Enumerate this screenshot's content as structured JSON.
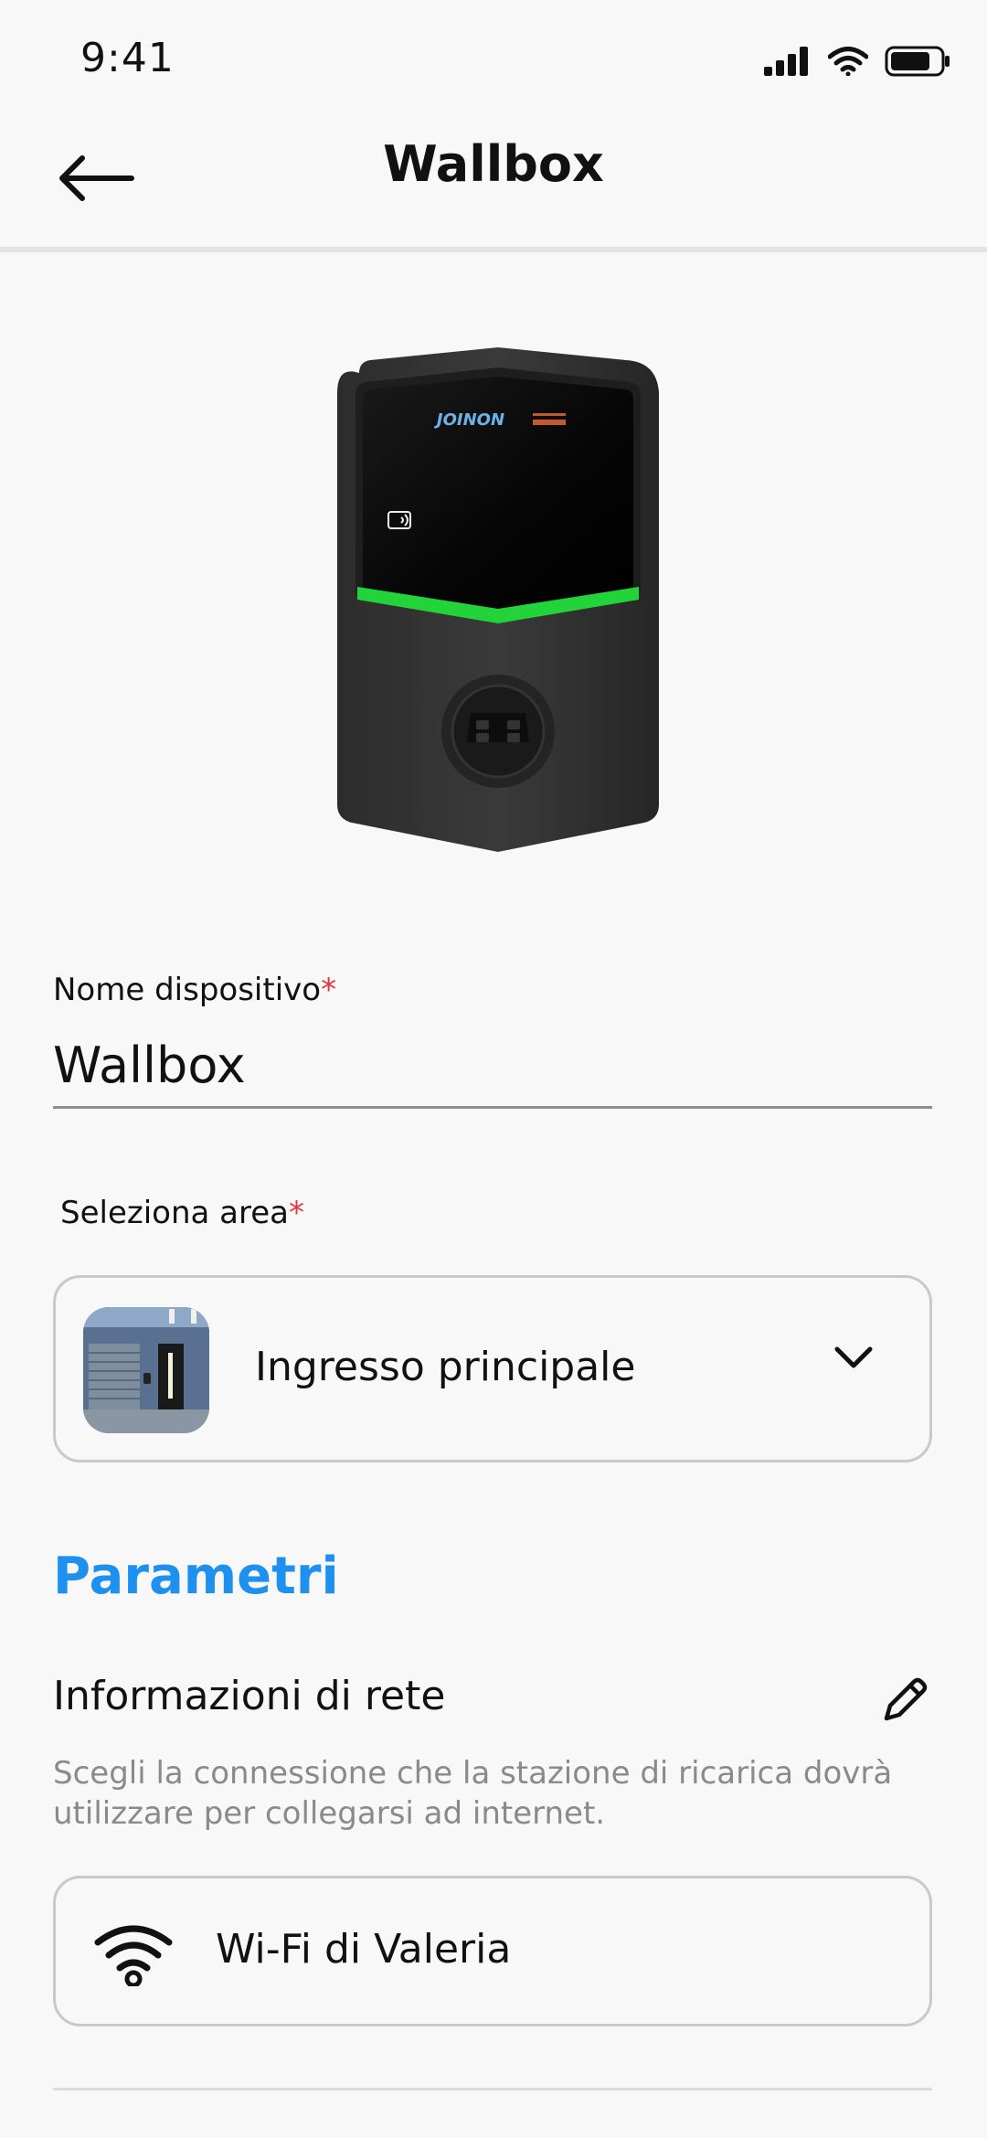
{
  "status_bar": {
    "time": "9:41",
    "icons": [
      "cellular-signal-icon",
      "wifi-icon",
      "battery-icon"
    ]
  },
  "header": {
    "title": "Wallbox",
    "back_icon": "arrow-left-icon"
  },
  "device": {
    "brand_logo": "JOINON"
  },
  "form": {
    "name_label": "Nome dispositivo",
    "name_required": "*",
    "name_value": "Wallbox",
    "area_label": "Seleziona area",
    "area_required": "*",
    "area_value": "Ingresso principale",
    "area_chevron_icon": "chevron-down-icon"
  },
  "parametri": {
    "title": "Parametri",
    "network_title": "Informazioni di rete",
    "network_desc": "Scegli la connessione che la stazione di ricarica dovrà utilizzare per collegarsi ad internet.",
    "edit_icon": "pencil-icon",
    "wifi_name": "Wi-Fi di Valeria"
  },
  "colors": {
    "accent": "#1e90f0",
    "required": "#e8323c",
    "led_green": "#22d43a",
    "background": "#f8f8f8"
  }
}
